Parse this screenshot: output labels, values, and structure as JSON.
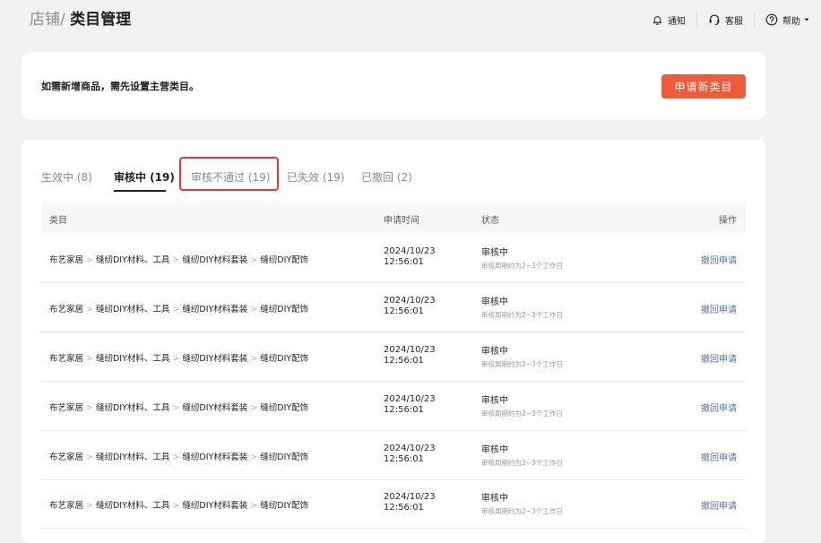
{
  "header": {
    "breadcrumb_parent": "店铺/",
    "breadcrumb_current": "类目管理",
    "notify": "通知",
    "service": "客服",
    "help": "帮助"
  },
  "notice": {
    "text": "如需新增商品，需先设置主营类目。",
    "button": "申请新类目"
  },
  "tabs": [
    {
      "label": "生效中 (8)"
    },
    {
      "label": "审核中 (19)"
    },
    {
      "label": "审核不通过 (19)"
    },
    {
      "label": "已失效 (19)"
    },
    {
      "label": "已撤回 (2)"
    }
  ],
  "active_tab": "审核中 (19)",
  "table": {
    "headers": {
      "category": "类目",
      "time": "申请时间",
      "status": "状态",
      "action": "操作"
    },
    "rows": [
      {
        "path": [
          "布艺家居",
          "缝纫DIY材料、工具",
          "缝纫DIY材料套装",
          "缝纫DIY配饰"
        ],
        "date": "2024/10/23",
        "clock": "12:56:01",
        "status": "审核中",
        "status_note": "审核周期约为2~3个工作日",
        "action": "撤回申请"
      },
      {
        "path": [
          "布艺家居",
          "缝纫DIY材料、工具",
          "缝纫DIY材料套装",
          "缝纫DIY配饰"
        ],
        "date": "2024/10/23",
        "clock": "12:56:01",
        "status": "审核中",
        "status_note": "审核周期约为2~3个工作日",
        "action": "撤回申请"
      },
      {
        "path": [
          "布艺家居",
          "缝纫DIY材料、工具",
          "缝纫DIY材料套装",
          "缝纫DIY配饰"
        ],
        "date": "2024/10/23",
        "clock": "12:56:01",
        "status": "审核中",
        "status_note": "审核周期约为2~3个工作日",
        "action": "撤回申请"
      },
      {
        "path": [
          "布艺家居",
          "缝纫DIY材料、工具",
          "缝纫DIY材料套装",
          "缝纫DIY配饰"
        ],
        "date": "2024/10/23",
        "clock": "12:56:01",
        "status": "审核中",
        "status_note": "审核周期约为2~3个工作日",
        "action": "撤回申请"
      },
      {
        "path": [
          "布艺家居",
          "缝纫DIY材料、工具",
          "缝纫DIY材料套装",
          "缝纫DIY配饰"
        ],
        "date": "2024/10/23",
        "clock": "12:56:01",
        "status": "审核中",
        "status_note": "审核周期约为2~3个工作日",
        "action": "撤回申请"
      },
      {
        "path": [
          "布艺家居",
          "缝纫DIY材料、工具",
          "缝纫DIY材料套装",
          "缝纫DIY配饰"
        ],
        "date": "2024/10/23",
        "clock": "12:56:01",
        "status": "审核中",
        "status_note": "审核周期约为2~3个工作日",
        "action": "撤回申请"
      }
    ]
  },
  "colors": {
    "accent": "#f05a38",
    "highlight_border": "#e8352e",
    "link": "#5474a8"
  }
}
